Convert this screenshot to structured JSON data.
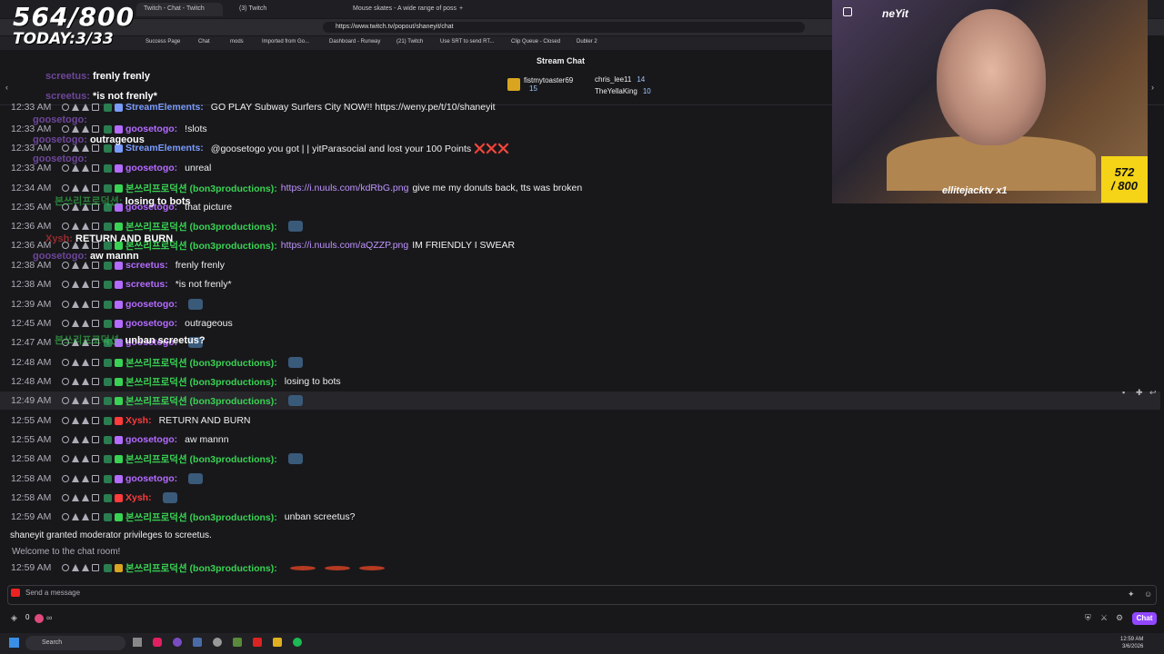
{
  "browser": {
    "tabs": [
      "Twitch - Chat - Twitch",
      "(3) Twitch",
      "Mouse skates - A wide range of poss"
    ],
    "url": "https://www.twitch.tv/popout/shaneyit/chat",
    "bookmarks": [
      "Success Page",
      "Chat",
      "mods",
      "Imported from Go...",
      "Dashboard - Runway",
      "(21) Twitch",
      "Use SRT to send RT...",
      "Clip Queue - Closed",
      "Dubler 2"
    ]
  },
  "overlay": {
    "counter_top": "564/800",
    "counter_bottom": "TODAY:3/33",
    "webcam_handle": "neYit",
    "webcam_name": "ellitejacktv x1",
    "goal_current": "572",
    "goal_total": "/ 800"
  },
  "chat": {
    "title": "Stream Chat",
    "gifters": [
      {
        "name": "fistmytoaster69",
        "count": "15"
      },
      {
        "name": "chris_lee11",
        "count": "14"
      },
      {
        "name": "TheYellaKing",
        "count": "10"
      }
    ],
    "ghost_lines": [
      {
        "user": "screetus:",
        "text": "frenly frenly",
        "color": "#b46bff"
      },
      {
        "user": "screetus:",
        "text": "*is not frenly*",
        "color": "#b46bff"
      },
      {
        "user": "goosetogo:",
        "text": "",
        "color": "#b46bff"
      },
      {
        "user": "goosetogo:",
        "text": "outrageous",
        "color": "#b46bff"
      },
      {
        "user": "goosetogo:",
        "text": "",
        "color": "#b46bff"
      },
      {
        "user": "본쓰리프로덕션:",
        "text": "losing to bots",
        "color": "#39d353"
      },
      {
        "user": "Xysh:",
        "text": "RETURN AND BURN",
        "color": "#ff3b3b"
      },
      {
        "user": "goosetogo:",
        "text": "aw mannn",
        "color": "#b46bff"
      },
      {
        "user": "본쓰리프로덕션:",
        "text": "unban screetus?",
        "color": "#39d353"
      }
    ],
    "lines": [
      {
        "time": "12:33 AM",
        "user": "StreamElements:",
        "color": "#7a9cff",
        "link": "",
        "text": "GO PLAY Subway Surfers City NOW!! https://weny.pe/t/10/shaneyit"
      },
      {
        "time": "12:33 AM",
        "user": "goosetogo:",
        "color": "#b46bff",
        "link": "",
        "text": "!slots"
      },
      {
        "time": "12:33 AM",
        "user": "StreamElements:",
        "color": "#7a9cff",
        "link": "",
        "text": "@goosetogo you got | | yitParasocial and lost your 100 Points ❌❌❌"
      },
      {
        "time": "12:33 AM",
        "user": "goosetogo:",
        "color": "#b46bff",
        "link": "",
        "text": "unreal"
      },
      {
        "time": "12:34 AM",
        "user": "본쓰리프로덕션 (bon3productions):",
        "color": "#39d353",
        "link": "https://i.nuuls.com/kdRbG.png",
        "text": "give me my donuts back, tts was broken"
      },
      {
        "time": "12:35 AM",
        "user": "goosetogo:",
        "color": "#b46bff",
        "link": "",
        "text": "that picture"
      },
      {
        "time": "12:36 AM",
        "user": "본쓰리프로덕션 (bon3productions):",
        "color": "#39d353",
        "link": "",
        "text": ""
      },
      {
        "time": "12:36 AM",
        "user": "본쓰리프로덕션 (bon3productions):",
        "color": "#39d353",
        "link": "https://i.nuuls.com/aQZZP.png",
        "text": "IM FRIENDLY I SWEAR"
      },
      {
        "time": "12:38 AM",
        "user": "screetus:",
        "color": "#b46bff",
        "link": "",
        "text": "frenly frenly"
      },
      {
        "time": "12:38 AM",
        "user": "screetus:",
        "color": "#b46bff",
        "link": "",
        "text": "*is not frenly*"
      },
      {
        "time": "12:39 AM",
        "user": "goosetogo:",
        "color": "#b46bff",
        "link": "",
        "text": ""
      },
      {
        "time": "12:45 AM",
        "user": "goosetogo:",
        "color": "#b46bff",
        "link": "",
        "text": "outrageous"
      },
      {
        "time": "12:47 AM",
        "user": "goosetogo:",
        "color": "#b46bff",
        "link": "",
        "text": ""
      },
      {
        "time": "12:48 AM",
        "user": "본쓰리프로덕션 (bon3productions):",
        "color": "#39d353",
        "link": "",
        "text": ""
      },
      {
        "time": "12:48 AM",
        "user": "본쓰리프로덕션 (bon3productions):",
        "color": "#39d353",
        "link": "",
        "text": "losing to bots"
      },
      {
        "time": "12:49 AM",
        "user": "본쓰리프로덕션 (bon3productions):",
        "color": "#39d353",
        "link": "",
        "text": ""
      },
      {
        "time": "12:55 AM",
        "user": "Xysh:",
        "color": "#ff3b3b",
        "link": "",
        "text": "RETURN AND BURN"
      },
      {
        "time": "12:55 AM",
        "user": "goosetogo:",
        "color": "#b46bff",
        "link": "",
        "text": "aw mannn"
      },
      {
        "time": "12:58 AM",
        "user": "본쓰리프로덕션 (bon3productions):",
        "color": "#39d353",
        "link": "",
        "text": ""
      },
      {
        "time": "12:58 AM",
        "user": "goosetogo:",
        "color": "#b46bff",
        "link": "",
        "text": ""
      },
      {
        "time": "12:58 AM",
        "user": "Xysh:",
        "color": "#ff3b3b",
        "link": "",
        "text": ""
      },
      {
        "time": "12:59 AM",
        "user": "본쓰리프로덕션 (bon3productions):",
        "color": "#39d353",
        "link": "",
        "text": "unban screetus?"
      }
    ],
    "system_mod": "shaneyit granted moderator privileges to screetus.",
    "system_welcome": "Welcome to the chat room!",
    "last_line": {
      "time": "12:59 AM",
      "user": "본쓰리프로덕션 (bon3productions):",
      "color": "#39d353"
    },
    "input_placeholder": "Send a message",
    "points": "0",
    "chat_button": "Chat"
  },
  "taskbar": {
    "search_label": "Search",
    "time": "12:59 AM",
    "date": "3/6/2026"
  }
}
